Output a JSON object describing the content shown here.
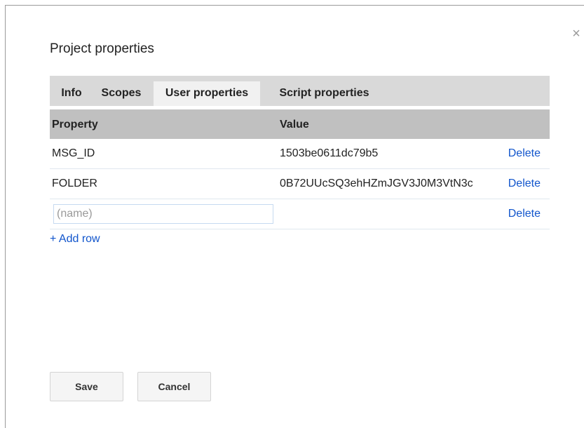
{
  "dialog": {
    "title": "Project properties",
    "close_glyph": "×",
    "close_icon": "close-icon"
  },
  "tabs": [
    {
      "label": "Info",
      "active": false
    },
    {
      "label": "Scopes",
      "active": false
    },
    {
      "label": "User properties",
      "active": true
    },
    {
      "label": "Script properties",
      "active": false
    }
  ],
  "table": {
    "headers": [
      "Property",
      "Value"
    ],
    "rows": [
      {
        "name": "MSG_ID",
        "value": "1503be0611dc79b5",
        "action": "Delete"
      },
      {
        "name": "FOLDER",
        "value": "0B72UUcSQ3ehHZmJGV3J0M3VtN3c",
        "action": "Delete"
      }
    ],
    "new_row": {
      "name_placeholder": "(name)",
      "name_value": "",
      "action": "Delete"
    }
  },
  "add_row_label": "+ Add row",
  "buttons": {
    "save": "Save",
    "cancel": "Cancel"
  },
  "colors": {
    "link": "#1155cc",
    "tab_bar": "#d9d9d9",
    "header_bg": "#c0c0c0"
  }
}
